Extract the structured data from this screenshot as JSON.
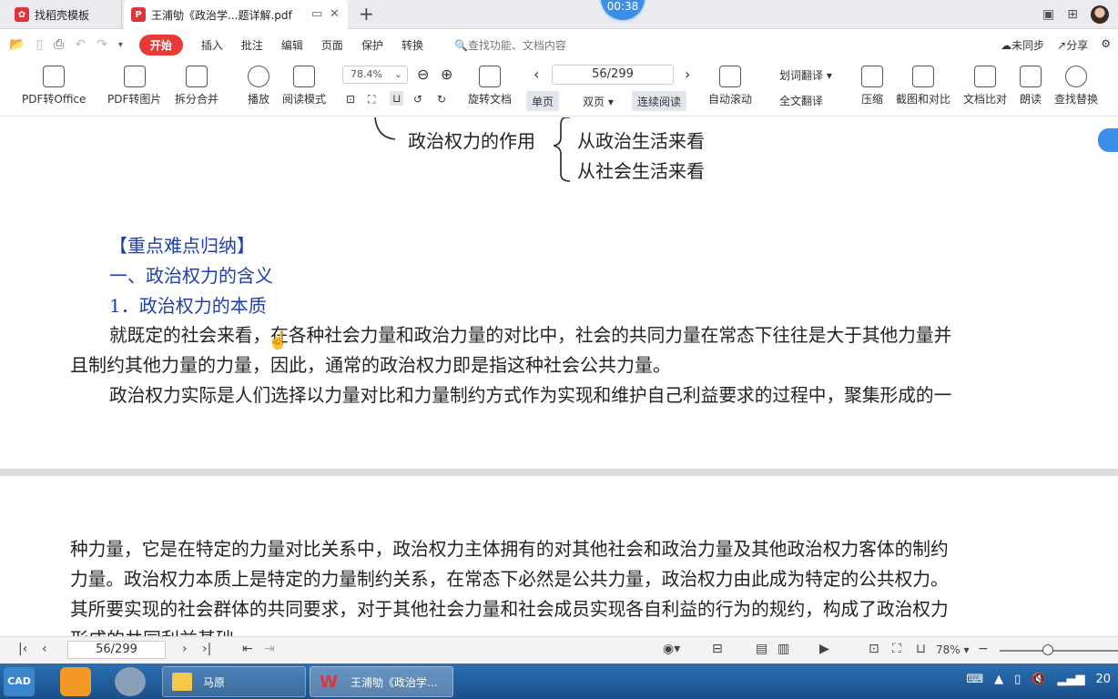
{
  "tabs": [
    {
      "label": "找稻壳模板"
    },
    {
      "label": "王浦劬《政治学...题详解.pdf"
    }
  ],
  "timer": "00:38",
  "menu": {
    "items": [
      "开始",
      "插入",
      "批注",
      "编辑",
      "页面",
      "保护",
      "转换"
    ],
    "search_placeholder": "查找功能、文档内容",
    "sync": "未同步",
    "share": "分享"
  },
  "toolbar": {
    "pdf_to_office": "PDF转Office",
    "pdf_to_image": "PDF转图片",
    "split_merge": "拆分合并",
    "play": "播放",
    "read_mode": "阅读模式",
    "zoom": "78.4%",
    "rotate": "旋转文档",
    "page": "56/299",
    "single_page": "单页",
    "double_page": "双页",
    "continuous": "连续阅读",
    "auto_scroll": "自动滚动",
    "word_translate": "划词翻译",
    "full_translate": "全文翻译",
    "compress": "压缩",
    "screenshot_compare": "截图和对比",
    "doc_compare": "文档比对",
    "read_aloud": "朗读",
    "find_replace": "查找替换"
  },
  "document": {
    "diagram_node": "政治权力的作用",
    "diagram_branches": [
      "从政治生活来看",
      "从社会生活来看"
    ],
    "heading_main": "【重点难点归纳】",
    "heading_1": "一、政治权力的含义",
    "heading_2": "1．政治权力的本质",
    "para1_line1": "就既定的社会来看，在各种社会力量和政治力量的对比中，社会的共同力量在常态下往往是大于其他力量并",
    "para1_line2": "且制约其他力量的力量，因此，通常的政治权力即是指这种社会公共力量。",
    "para2_line1": "政治权力实际是人们选择以力量对比和力量制约方式作为实现和维护自己利益要求的过程中，聚集形成的一",
    "page2_line1": "种力量，它是在特定的力量对比关系中，政治权力主体拥有的对其他社会和政治力量及其他政治权力客体的制约",
    "page2_line2": "力量。政治权力本质上是特定的力量制约关系，在常态下必然是公共力量，政治权力由此成为特定的公共权力。",
    "page2_line3": "其所要实现的社会群体的共同要求，对于其他社会力量和社会成员实现各自利益的行为的规约，构成了政治权力",
    "page2_line4": "形成的共同利益基础"
  },
  "statusbar": {
    "page": "56/299",
    "zoom": "78%"
  },
  "taskbar": {
    "start": "CAD",
    "tasks": [
      "马原",
      "王浦劬《政治学..."
    ],
    "clock": "20"
  }
}
